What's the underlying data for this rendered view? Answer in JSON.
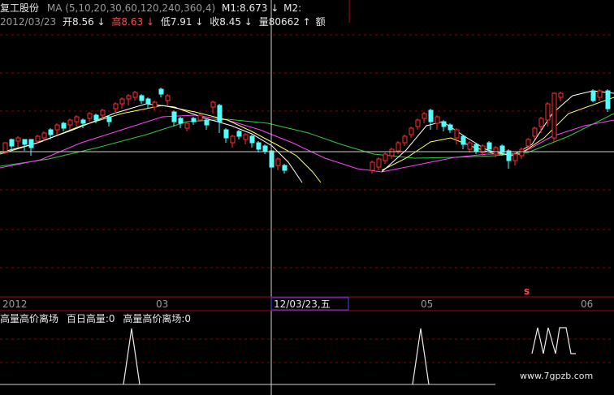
{
  "header": {
    "stock_name": "复工股份",
    "ma_label": "MA (5,10,20,30,60,120,240,360,4)",
    "m1_label": "M1:8.673 ↓",
    "m2_label": "M2:",
    "date": "2012/03/23",
    "open_label": "开8.56 ↓",
    "high_label": "高8.63 ↓",
    "low_label": "低7.91 ↓",
    "close_label": "收8.45 ↓",
    "volume_label": "量80662 ↑",
    "amount_label": "额"
  },
  "axis": {
    "ticks": [
      "2012",
      "03",
      "05",
      "06"
    ],
    "cursor_date": "12/03/23,五",
    "marker": "s"
  },
  "indicator": {
    "title": "高量高价离场",
    "field1_label": "百日高量:0",
    "field2_label": "高量高价离场:0"
  },
  "watermark": "www.7gpzb.com",
  "colors": {
    "up": "#ff3030",
    "down": "#54ffff",
    "ma5": "#ffffff",
    "ma10": "#ffff66",
    "ma20": "#ff40ff",
    "ma30": "#2ecc40",
    "grid": "#8b0000",
    "axis_border": "#b00020"
  }
}
